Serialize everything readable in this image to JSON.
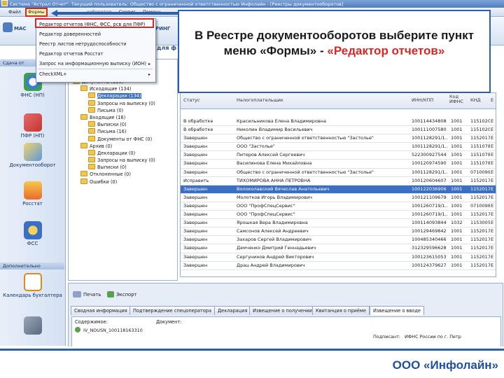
{
  "window": {
    "title": "Система \"Астрал Отчет\". Текущий пользователь: Общество с ограниченной ответственностью Инфолайн - [Реестры документооборотов]"
  },
  "menubar": {
    "file": "Файл",
    "forms": "Формы",
    "partial": "ооборотов",
    "service": "Сервис",
    "help": "Помощь"
  },
  "ribbon": {
    "master": "МАС",
    "ring": "РИНГ",
    "forms_caption": "для ф"
  },
  "form_menu": {
    "items": [
      {
        "label": "Редактор отчетов (ФНС, ФСС, рсв для ПФР)"
      },
      {
        "label": "Редактор доверенностей"
      },
      {
        "label": "Реестр листов нетрудоспособности"
      },
      {
        "label": "Редактор отчетов Росстат"
      },
      {
        "label": "Запрос на информационную выписку (ИОН)"
      },
      {
        "label": "CheckXML+"
      }
    ]
  },
  "sidebar": {
    "section1": "Сдача от",
    "items": [
      {
        "label": "ФНС (НП)"
      },
      {
        "label": "ПФР (НП)"
      },
      {
        "label": "Документооборот"
      },
      {
        "label": "Росстат"
      },
      {
        "label": "ФСС"
      }
    ],
    "section2": "Дополнительно",
    "extra": [
      {
        "label": "Календарь бухгалтера"
      },
      {
        "label": ""
      }
    ]
  },
  "tree": {
    "rows": [
      {
        "label": "Документы (150)",
        "indent": 0
      },
      {
        "label": "Исходящие (134)",
        "indent": 1
      },
      {
        "label": "Декларации (134)",
        "indent": 2,
        "selected": true
      },
      {
        "label": "Запросы на выписку (0)",
        "indent": 2
      },
      {
        "label": "Письма (0)",
        "indent": 2
      },
      {
        "label": "Входящие (16)",
        "indent": 1
      },
      {
        "label": "Выписки (0)",
        "indent": 2
      },
      {
        "label": "Письма (16)",
        "indent": 2
      },
      {
        "label": "Документы от ФНС (0)",
        "indent": 2
      },
      {
        "label": "Архив (0)",
        "indent": 1
      },
      {
        "label": "Декларации (0)",
        "indent": 2
      },
      {
        "label": "Запросы на выписку (0)",
        "indent": 2
      },
      {
        "label": "Выписки (0)",
        "indent": 2
      },
      {
        "label": "Отклоненные (0)",
        "indent": 1
      },
      {
        "label": "Ошибки (0)",
        "indent": 1
      }
    ]
  },
  "grid": {
    "headers": [
      "Статус",
      "Налогоплательщик",
      "ИНН/КПП",
      "Код ИФНС",
      "КНД",
      "Е"
    ],
    "rows": [
      {
        "status": "В обработке",
        "payer": "Красильникова Елена Владимировна",
        "inn": "100114434808",
        "ifns": "1001",
        "knd": "1151020",
        "extra": "Е"
      },
      {
        "status": "В обработке",
        "payer": "Николин Владимир Васильевич",
        "inn": "100111007580",
        "ifns": "1001",
        "knd": "1151020",
        "extra": "Е"
      },
      {
        "status": "Завершен",
        "payer": "Общество с ограниченной ответственностью \"Застолье\"",
        "inn": "1001128291/1...",
        "ifns": "1001",
        "knd": "1152017",
        "extra": "Е"
      },
      {
        "status": "Завершен",
        "payer": "ООО \"Застолье\"",
        "inn": "1001128291/1...",
        "ifns": "1001",
        "knd": "1151078",
        "extra": "Е"
      },
      {
        "status": "Завершен",
        "payer": "Питеров Алексей Сергеевич",
        "inn": "522300927544",
        "ifns": "1001",
        "knd": "1151078",
        "extra": "Е"
      },
      {
        "status": "Завершен",
        "payer": "Василинова Елена Михайловна",
        "inn": "100120974590",
        "ifns": "1001",
        "knd": "1151078",
        "extra": "Е"
      },
      {
        "status": "Завершен",
        "payer": "Общество с ограниченной ответственностью \"Застолье\"",
        "inn": "1001128291/1...",
        "ifns": "1001",
        "knd": "0710099",
        "extra": "Е"
      },
      {
        "status": "Исправить",
        "payer": "ТИХОМИРОВА АННА ПЕТРОВНА",
        "inn": "100120604607",
        "ifns": "1001",
        "knd": "1152017",
        "extra": "Е"
      },
      {
        "status": "Завершен",
        "payer": "Волоколавский Вячеслав Анатольевич",
        "inn": "100122036906",
        "ifns": "1001",
        "knd": "1152017",
        "extra": "Е",
        "selected": true
      },
      {
        "status": "Завершен",
        "payer": "Молотков Игорь Владимирович",
        "inn": "100121109679",
        "ifns": "1001",
        "knd": "1152017",
        "extra": "Е"
      },
      {
        "status": "Завершен",
        "payer": "ООО \"ПрофСпецСервис\"",
        "inn": "1001260719/1...",
        "ifns": "1001",
        "knd": "0710098",
        "extra": "Е"
      },
      {
        "status": "Завершен",
        "payer": "ООО \"ПрофСпецСервис\"",
        "inn": "1001260719/1...",
        "ifns": "1001",
        "knd": "1152017",
        "extra": "Е"
      },
      {
        "status": "Завершен",
        "payer": "Ярошкая Вера Владимировна",
        "inn": "100114093844",
        "ifns": "1032",
        "knd": "1153005",
        "extra": "Е"
      },
      {
        "status": "Завершен",
        "payer": "Самсонов Алексей Андреевич",
        "inn": "100129469842",
        "ifns": "1001",
        "knd": "1152017",
        "extra": "Е"
      },
      {
        "status": "Завершен",
        "payer": "Захаров Сергей Владимирович",
        "inn": "100485340466",
        "ifns": "1001",
        "knd": "1152017",
        "extra": "Е"
      },
      {
        "status": "Завершен",
        "payer": "Демченко Дмитрий Геннадьевич",
        "inn": "312329596628",
        "ifns": "1001",
        "knd": "1152017",
        "extra": "Е"
      },
      {
        "status": "Завершен",
        "payer": "Сергунинов Андрей Викторович",
        "inn": "100123615053",
        "ifns": "1001",
        "knd": "1152017",
        "extra": "Е"
      },
      {
        "status": "Завершен",
        "payer": "Драц Андрей Владимирович",
        "inn": "100124379627",
        "ifns": "1001",
        "knd": "1152017",
        "extra": "Е"
      }
    ]
  },
  "bottom": {
    "print": "Печать",
    "export": "Экспорт",
    "tabs": [
      "Сводная информация",
      "Подтверждение спецоператора",
      "Декларация",
      "Извещение о получении",
      "Квитанция о приёме",
      "Извещение о вводе"
    ],
    "content_label": "Содержимое:",
    "file_name": "IV_NOUSN_100118163310",
    "document_label": "Документ:",
    "signer_label": "Подписант:",
    "signer_value": "ИФНС России по г. Петр"
  },
  "callout": {
    "line1": "В Реестре документооборотов выберите пункт меню «Формы» - ",
    "highlight": "«Редактор отчетов»"
  },
  "footer": {
    "company": "ООО «Инфолайн»"
  },
  "colors": {
    "accent": "#2d5fb0",
    "highlight": "#e02424",
    "selection": "#3b6fc6"
  }
}
